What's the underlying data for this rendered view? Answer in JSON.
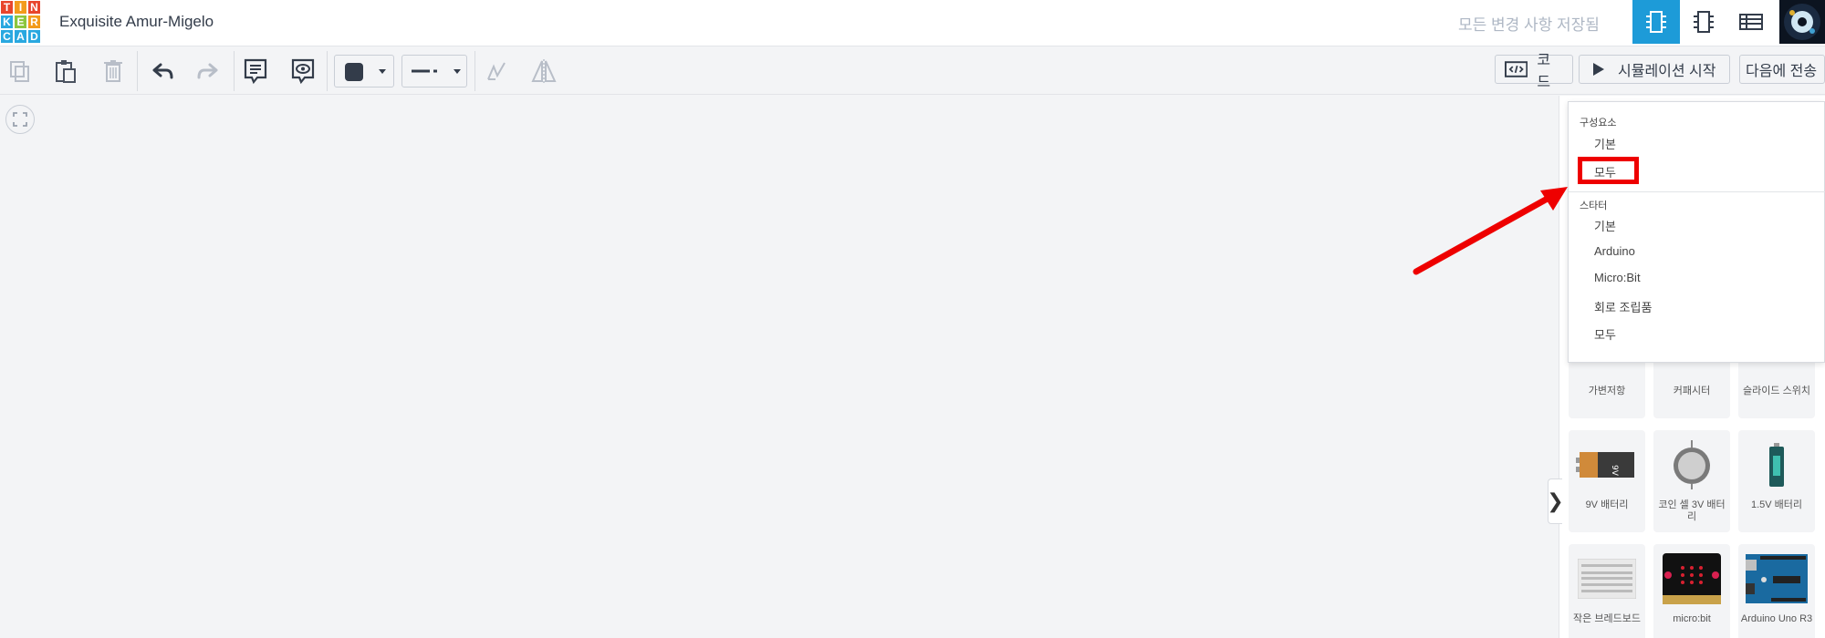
{
  "header": {
    "logo_letters": [
      "T",
      "I",
      "N",
      "K",
      "E",
      "R",
      "C",
      "A",
      "D"
    ],
    "logo_colors": [
      "#e8452c",
      "#f39b1b",
      "#e8452c",
      "#29a8e0",
      "#8cc63e",
      "#f39b1b",
      "#29a8e0",
      "#29a8e0",
      "#29a8e0"
    ],
    "project_title": "Exquisite Amur-Migelo",
    "save_status": "모든 변경 사항 저장됨",
    "views": [
      "circuit-view-icon",
      "schematic-view-icon",
      "component-list-icon"
    ]
  },
  "toolbar": {
    "code_label": "코드",
    "simulate_label": "시뮬레이션 시작",
    "send_label": "다음에 전송",
    "icons": [
      "copy-icon",
      "paste-icon",
      "delete-icon",
      "undo-icon",
      "redo-icon",
      "notes-icon",
      "notes-visibility-icon",
      "color-icon",
      "line-style-icon",
      "rotate-icon",
      "flip-icon"
    ]
  },
  "menu": {
    "header_components": "구성요소",
    "items_components": [
      "기본",
      "모두"
    ],
    "header_starters": "스타터",
    "items_starters": [
      "기본",
      "Arduino",
      "Micro:Bit",
      "회로 조립품",
      "모두"
    ]
  },
  "components": [
    {
      "label": "가변저항",
      "icon": "potentiometer-icon"
    },
    {
      "label": "커패시터",
      "icon": "capacitor-icon"
    },
    {
      "label": "슬라이드 스위치",
      "icon": "slide-switch-icon"
    },
    {
      "label": "9V 배터리",
      "icon": "battery-9v-icon"
    },
    {
      "label": "코인 셀 3V 배터리",
      "icon": "coin-cell-icon"
    },
    {
      "label": "1.5V 배터리",
      "icon": "battery-aa-icon"
    },
    {
      "label": "작은 브레드보드",
      "icon": "breadboard-icon"
    },
    {
      "label": "micro:bit",
      "icon": "microbit-icon"
    },
    {
      "label": "Arduino Uno R3",
      "icon": "arduino-icon"
    }
  ],
  "colors": {
    "accent": "#1d9bd8",
    "highlight": "#ee0000"
  }
}
